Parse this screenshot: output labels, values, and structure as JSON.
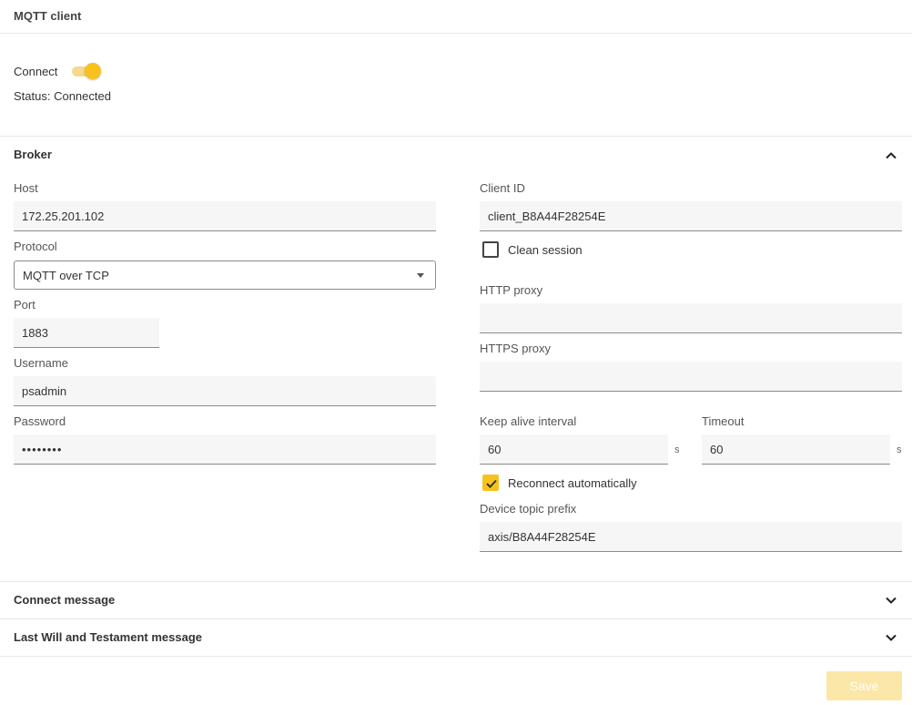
{
  "header": {
    "title": "MQTT client"
  },
  "connection": {
    "connect_label": "Connect",
    "connect_enabled": true,
    "status_text": "Status: Connected",
    "toggle_color": "#f7c21e"
  },
  "broker": {
    "title": "Broker",
    "expanded": true,
    "host": {
      "label": "Host",
      "value": "172.25.201.102"
    },
    "protocol": {
      "label": "Protocol",
      "value": "MQTT over TCP"
    },
    "port": {
      "label": "Port",
      "value": "1883"
    },
    "username": {
      "label": "Username",
      "value": "psadmin"
    },
    "password": {
      "label": "Password",
      "value": "••••••••"
    },
    "client_id": {
      "label": "Client ID",
      "value": "client_B8A44F28254E"
    },
    "clean_session": {
      "label": "Clean session",
      "checked": false
    },
    "http_proxy": {
      "label": "HTTP proxy",
      "value": ""
    },
    "https_proxy": {
      "label": "HTTPS proxy",
      "value": ""
    },
    "keep_alive": {
      "label": "Keep alive interval",
      "value": "60",
      "unit": "s"
    },
    "timeout": {
      "label": "Timeout",
      "value": "60",
      "unit": "s"
    },
    "reconnect": {
      "label": "Reconnect automatically",
      "checked": true
    },
    "topic_prefix": {
      "label": "Device topic prefix",
      "value": "axis/B8A44F28254E"
    }
  },
  "sections": {
    "connect_message": {
      "title": "Connect message",
      "expanded": false
    },
    "lwt_message": {
      "title": "Last Will and Testament message",
      "expanded": false
    }
  },
  "actions": {
    "save_label": "Save"
  },
  "icons": {
    "chevron_up": "chevron-up-icon",
    "chevron_down": "chevron-down-icon",
    "caret": "caret-down-icon",
    "check": "check-icon"
  },
  "colors": {
    "accent": "#f7c21e",
    "save_disabled": "#fbe7a7"
  }
}
